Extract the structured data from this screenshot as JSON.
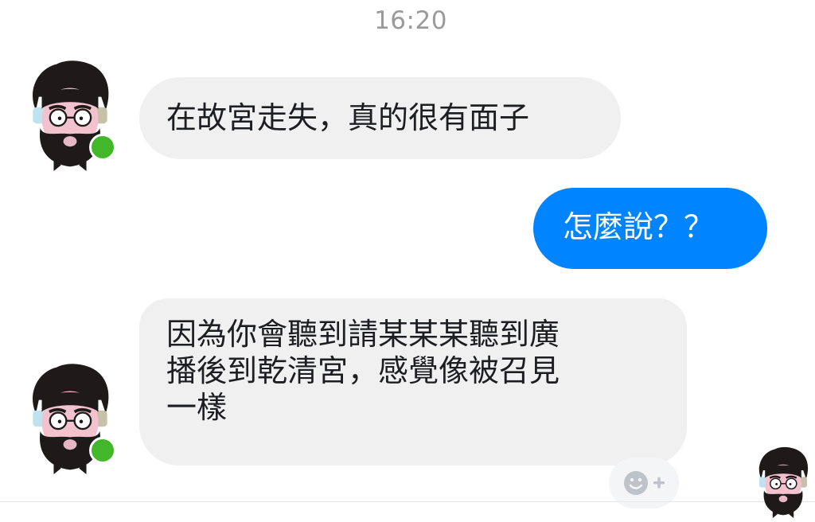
{
  "timestamp": "16:20",
  "messages": [
    {
      "direction": "incoming",
      "lines": [
        "在故宮走失，真的很有面子"
      ]
    },
    {
      "direction": "outgoing",
      "lines": [
        "怎麼說？？"
      ]
    },
    {
      "direction": "incoming",
      "lines": [
        "因為你會聽到請某某某聽到廣",
        "播後到乾清宮，感覺像被召見",
        "一樣"
      ]
    }
  ],
  "icons": {
    "contact_avatar": "bearded-man-with-glasses-avatar-icon",
    "online_status": "online-dot-icon",
    "reaction": "smiley-plus-icon",
    "seen_avatar": "seen-receipt-avatar-icon"
  },
  "colors": {
    "outgoing_bubble": "#0084ff",
    "incoming_bubble": "#f1f0f0",
    "online_dot": "#42b72a",
    "timestamp": "#9a9a9a"
  }
}
